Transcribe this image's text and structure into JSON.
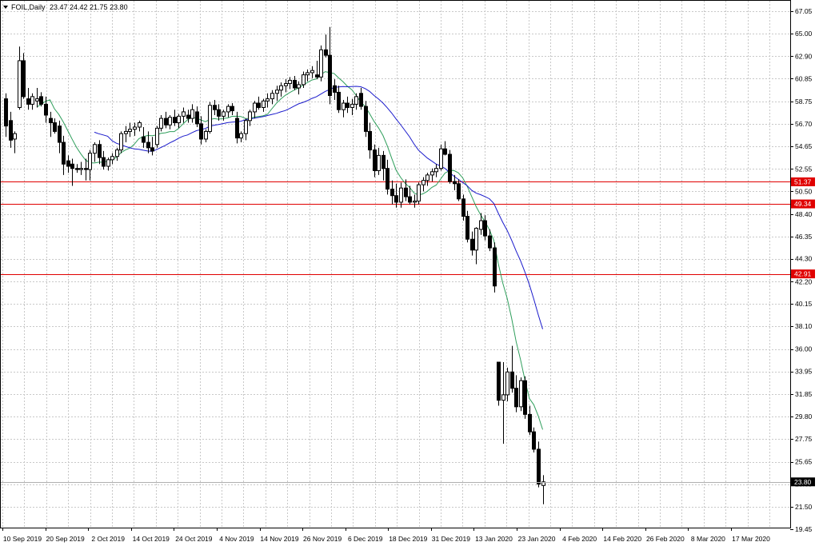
{
  "header": {
    "symbol": "FOIL,Daily",
    "ohlc": "23.47 24.42 21.75 23.80",
    "menu_icon": "triangle-down-icon"
  },
  "colors": {
    "ma_fast": "#2e9e5b",
    "ma_slow": "#1a1acc",
    "level": "#e00000",
    "badge": "#e00000",
    "price_badge": "#000000",
    "candle": "#000000",
    "grid": "#c8c8c8"
  },
  "chart_data": {
    "type": "candlestick",
    "y_ticks": [
      "67.05",
      "65.00",
      "62.90",
      "60.85",
      "58.75",
      "56.70",
      "54.65",
      "52.55",
      "50.50",
      "48.40",
      "46.35",
      "44.30",
      "42.20",
      "40.15",
      "38.10",
      "36.00",
      "33.95",
      "31.85",
      "29.80",
      "27.75",
      "25.65",
      "23.60",
      "21.50",
      "19.45"
    ],
    "ylim": [
      19.45,
      67.05
    ],
    "x_labels": [
      "10 Sep 2019",
      "20 Sep 2019",
      "2 Oct 2019",
      "14 Oct 2019",
      "24 Oct 2019",
      "4 Nov 2019",
      "14 Nov 2019",
      "26 Nov 2019",
      "6 Dec 2019",
      "18 Dec 2019",
      "31 Dec 2019",
      "13 Jan 2020",
      "23 Jan 2020",
      "4 Feb 2020",
      "14 Feb 2020",
      "26 Feb 2020",
      "8 Mar 2020",
      "17 Mar 2020"
    ],
    "horizontal_levels": [
      51.37,
      49.34,
      42.91
    ],
    "level_labels": [
      "51.37",
      "49.34",
      "42.91"
    ],
    "last_price": 23.8,
    "last_price_label": "23.80",
    "candles": [
      [
        59.0,
        59.5,
        55.5,
        56.5
      ],
      [
        57.0,
        57.8,
        54.5,
        55.2
      ],
      [
        55.3,
        56.0,
        54.0,
        55.8
      ],
      [
        58.2,
        63.8,
        58.0,
        62.5
      ],
      [
        62.5,
        63.2,
        59.0,
        59.2
      ],
      [
        59.0,
        60.0,
        58.0,
        58.5
      ],
      [
        58.5,
        59.5,
        58.0,
        59.2
      ],
      [
        58.8,
        60.0,
        58.2,
        59.0
      ],
      [
        59.2,
        59.6,
        58.3,
        58.5
      ],
      [
        58.5,
        59.2,
        56.8,
        57.5
      ],
      [
        57.2,
        57.8,
        55.5,
        56.8
      ],
      [
        56.8,
        57.2,
        55.8,
        56.0
      ],
      [
        56.5,
        57.0,
        54.0,
        55.0
      ],
      [
        55.0,
        55.6,
        52.0,
        53.0
      ],
      [
        53.3,
        53.8,
        52.2,
        52.8
      ],
      [
        53.0,
        53.5,
        51.0,
        52.6
      ],
      [
        52.6,
        53.0,
        52.2,
        52.5
      ],
      [
        52.5,
        53.2,
        52.0,
        52.6
      ],
      [
        52.6,
        53.5,
        51.5,
        52.5
      ],
      [
        52.5,
        54.3,
        51.5,
        54.0
      ],
      [
        54.0,
        55.0,
        53.2,
        54.8
      ],
      [
        54.8,
        55.2,
        53.0,
        53.6
      ],
      [
        53.6,
        54.2,
        52.5,
        52.8
      ],
      [
        52.8,
        53.6,
        52.4,
        53.4
      ],
      [
        53.4,
        54.0,
        53.0,
        53.7
      ],
      [
        53.7,
        54.5,
        53.3,
        54.3
      ],
      [
        54.3,
        56.0,
        54.0,
        55.8
      ],
      [
        55.8,
        56.5,
        55.0,
        56.0
      ],
      [
        56.0,
        56.8,
        55.5,
        56.2
      ],
      [
        56.2,
        56.8,
        55.6,
        56.4
      ],
      [
        56.4,
        57.0,
        56.0,
        56.8
      ],
      [
        55.5,
        56.4,
        54.5,
        55.0
      ],
      [
        55.0,
        56.0,
        54.0,
        54.5
      ],
      [
        54.5,
        55.5,
        53.8,
        54.2
      ],
      [
        54.8,
        56.5,
        54.5,
        56.3
      ],
      [
        56.3,
        57.5,
        56.0,
        57.2
      ],
      [
        57.2,
        57.8,
        56.3,
        56.6
      ],
      [
        56.6,
        57.5,
        56.2,
        57.3
      ],
      [
        57.3,
        58.0,
        56.5,
        56.8
      ],
      [
        56.8,
        57.6,
        56.3,
        57.4
      ],
      [
        57.4,
        58.2,
        56.8,
        57.8
      ],
      [
        57.5,
        58.0,
        56.8,
        57.2
      ],
      [
        57.2,
        58.5,
        56.8,
        58.0
      ],
      [
        57.8,
        58.3,
        56.4,
        56.7
      ],
      [
        56.7,
        57.4,
        54.8,
        55.3
      ],
      [
        55.3,
        56.2,
        55.0,
        56.0
      ],
      [
        56.0,
        58.7,
        55.8,
        58.4
      ],
      [
        58.4,
        58.9,
        57.5,
        58.0
      ],
      [
        58.0,
        58.5,
        57.0,
        57.4
      ],
      [
        57.4,
        58.0,
        57.0,
        57.8
      ],
      [
        57.8,
        58.5,
        57.3,
        58.3
      ],
      [
        58.3,
        58.6,
        57.5,
        57.9
      ],
      [
        57.2,
        57.8,
        54.9,
        55.4
      ],
      [
        55.4,
        56.0,
        55.0,
        55.8
      ],
      [
        55.8,
        57.2,
        55.2,
        57.0
      ],
      [
        57.0,
        58.0,
        56.5,
        57.8
      ],
      [
        57.8,
        58.8,
        57.2,
        58.6
      ],
      [
        58.6,
        59.2,
        58.0,
        58.2
      ],
      [
        58.2,
        59.0,
        57.8,
        58.8
      ],
      [
        58.8,
        59.5,
        58.2,
        59.0
      ],
      [
        59.0,
        59.8,
        58.5,
        59.5
      ],
      [
        59.5,
        60.2,
        58.8,
        59.8
      ],
      [
        59.8,
        60.5,
        59.2,
        60.2
      ],
      [
        60.2,
        60.8,
        59.6,
        60.4
      ],
      [
        60.4,
        61.0,
        59.9,
        60.7
      ],
      [
        60.7,
        61.1,
        59.8,
        60.0
      ],
      [
        60.0,
        60.6,
        59.4,
        60.3
      ],
      [
        60.3,
        61.5,
        60.0,
        61.2
      ],
      [
        61.2,
        61.7,
        60.6,
        61.4
      ],
      [
        61.4,
        62.0,
        60.9,
        61.6
      ],
      [
        61.2,
        62.5,
        60.8,
        61.0
      ],
      [
        61.0,
        63.9,
        60.6,
        63.5
      ],
      [
        63.5,
        64.9,
        62.8,
        63.0
      ],
      [
        63.0,
        65.6,
        58.5,
        59.3
      ],
      [
        60.2,
        60.8,
        58.9,
        59.6
      ],
      [
        59.6,
        60.2,
        57.7,
        58.0
      ],
      [
        58.0,
        58.9,
        57.3,
        58.6
      ],
      [
        58.6,
        59.2,
        57.7,
        58.2
      ],
      [
        58.2,
        59.0,
        57.5,
        58.5
      ],
      [
        58.5,
        59.5,
        58.0,
        59.2
      ],
      [
        59.5,
        60.0,
        58.0,
        58.3
      ],
      [
        58.3,
        58.8,
        55.5,
        56.0
      ],
      [
        56.0,
        56.8,
        53.5,
        54.3
      ],
      [
        54.3,
        54.8,
        51.8,
        52.4
      ],
      [
        52.4,
        54.5,
        52.0,
        53.8
      ],
      [
        53.8,
        54.2,
        51.5,
        52.6
      ],
      [
        52.6,
        53.4,
        50.2,
        50.7
      ],
      [
        50.7,
        51.5,
        49.3,
        50.1
      ],
      [
        50.1,
        51.2,
        49.0,
        49.5
      ],
      [
        49.5,
        51.3,
        49.0,
        50.8
      ],
      [
        50.8,
        51.6,
        49.6,
        50.0
      ],
      [
        50.0,
        51.0,
        49.3,
        49.5
      ],
      [
        49.5,
        50.2,
        49.0,
        49.6
      ],
      [
        49.6,
        51.3,
        49.3,
        51.1
      ],
      [
        51.1,
        51.8,
        50.5,
        51.5
      ],
      [
        51.5,
        52.2,
        51.0,
        52.0
      ],
      [
        52.0,
        52.6,
        51.4,
        52.3
      ],
      [
        52.3,
        53.0,
        51.8,
        52.6
      ],
      [
        52.6,
        54.8,
        52.4,
        54.4
      ],
      [
        54.4,
        55.1,
        53.8,
        53.9
      ],
      [
        53.9,
        54.3,
        51.2,
        51.4
      ],
      [
        51.4,
        52.0,
        50.6,
        51.2
      ],
      [
        51.2,
        51.6,
        49.6,
        49.8
      ],
      [
        49.8,
        50.2,
        47.8,
        48.2
      ],
      [
        48.2,
        48.7,
        45.8,
        46.1
      ],
      [
        46.1,
        46.8,
        44.6,
        45.1
      ],
      [
        45.1,
        47.2,
        43.8,
        47.1
      ],
      [
        47.0,
        48.5,
        46.5,
        47.8
      ],
      [
        47.8,
        48.3,
        46.0,
        46.4
      ],
      [
        46.4,
        47.0,
        45.0,
        45.3
      ],
      [
        45.3,
        45.8,
        41.2,
        41.8
      ],
      [
        34.8,
        34.8,
        30.8,
        31.3
      ],
      [
        31.3,
        34.8,
        27.3,
        31.8
      ],
      [
        31.8,
        34.3,
        31.2,
        33.9
      ],
      [
        33.9,
        36.3,
        32.0,
        32.4
      ],
      [
        32.4,
        33.6,
        30.2,
        30.7
      ],
      [
        30.7,
        33.4,
        30.3,
        33.1
      ],
      [
        33.1,
        33.5,
        29.6,
        30.0
      ],
      [
        30.0,
        30.8,
        28.1,
        28.4
      ],
      [
        28.4,
        28.8,
        26.5,
        26.8
      ],
      [
        26.8,
        27.5,
        23.3,
        23.6
      ],
      [
        23.47,
        24.42,
        21.75,
        23.8
      ]
    ]
  }
}
